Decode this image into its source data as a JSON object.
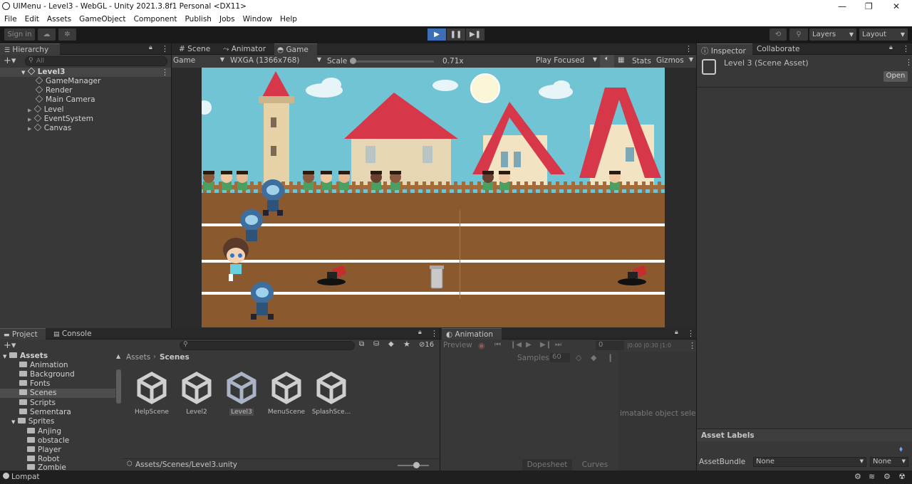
{
  "window": {
    "title": "UIMenu - Level3 - WebGL - Unity 2021.3.8f1 Personal <DX11>",
    "min": "—",
    "max": "❐",
    "close": "✕"
  },
  "menu": [
    "File",
    "Edit",
    "Assets",
    "GameObject",
    "Component",
    "Publish",
    "Jobs",
    "Window",
    "Help"
  ],
  "toolbar": {
    "signin": "Sign in",
    "layers": "Layers",
    "layout": "Layout"
  },
  "hierarchy": {
    "tab": "Hierarchy",
    "search_placeholder": "All",
    "root": "Level3",
    "items": [
      "GameManager",
      "Render",
      "Main Camera",
      "Level",
      "EventSystem",
      "Canvas"
    ]
  },
  "scene_tabs": [
    "Scene",
    "Animator",
    "Game"
  ],
  "game_bar": {
    "display": "Game",
    "resolution": "WXGA (1366x768)",
    "scale_label": "Scale",
    "scale_value": "0.71x",
    "play_mode": "Play Focused",
    "stats": "Stats",
    "gizmos": "Gizmos"
  },
  "inspector": {
    "tabs": [
      "Inspector",
      "Collaborate"
    ],
    "title": "Level 3 (Scene Asset)",
    "open": "Open",
    "asset_labels": "Asset Labels",
    "bundle_label": "AssetBundle",
    "bundle_value": "None",
    "bundle_variant": "None"
  },
  "project": {
    "tabs": [
      "Project",
      "Console"
    ],
    "hidden_count": "16",
    "breadcrumb": [
      "Assets",
      "Scenes"
    ],
    "tree": [
      "Assets",
      "Animation",
      "Background",
      "Fonts",
      "Scenes",
      "Scripts",
      "Sementara",
      "Sprites",
      "Anjing",
      "obstacle",
      "Player",
      "Robot",
      "Zombie"
    ],
    "assets": [
      "HelpScene",
      "Level2",
      "Level3",
      "MenuScene",
      "SplashSce..."
    ],
    "path": "Assets/Scenes/Level3.unity"
  },
  "animation": {
    "tab": "Animation",
    "preview": "Preview",
    "frame": "0",
    "samples_label": "Samples",
    "samples_value": "60",
    "ruler": "|0:00  |0:30  |1:0",
    "empty_msg": "imatable object sele",
    "dopesheet": "Dopesheet",
    "curves": "Curves"
  },
  "status": {
    "text": "Lompat"
  },
  "colors": {
    "accent": "#3d6fb6",
    "sky": "#6fc3d3",
    "dirt": "#8a5a2e",
    "roof": "#d6384a"
  }
}
